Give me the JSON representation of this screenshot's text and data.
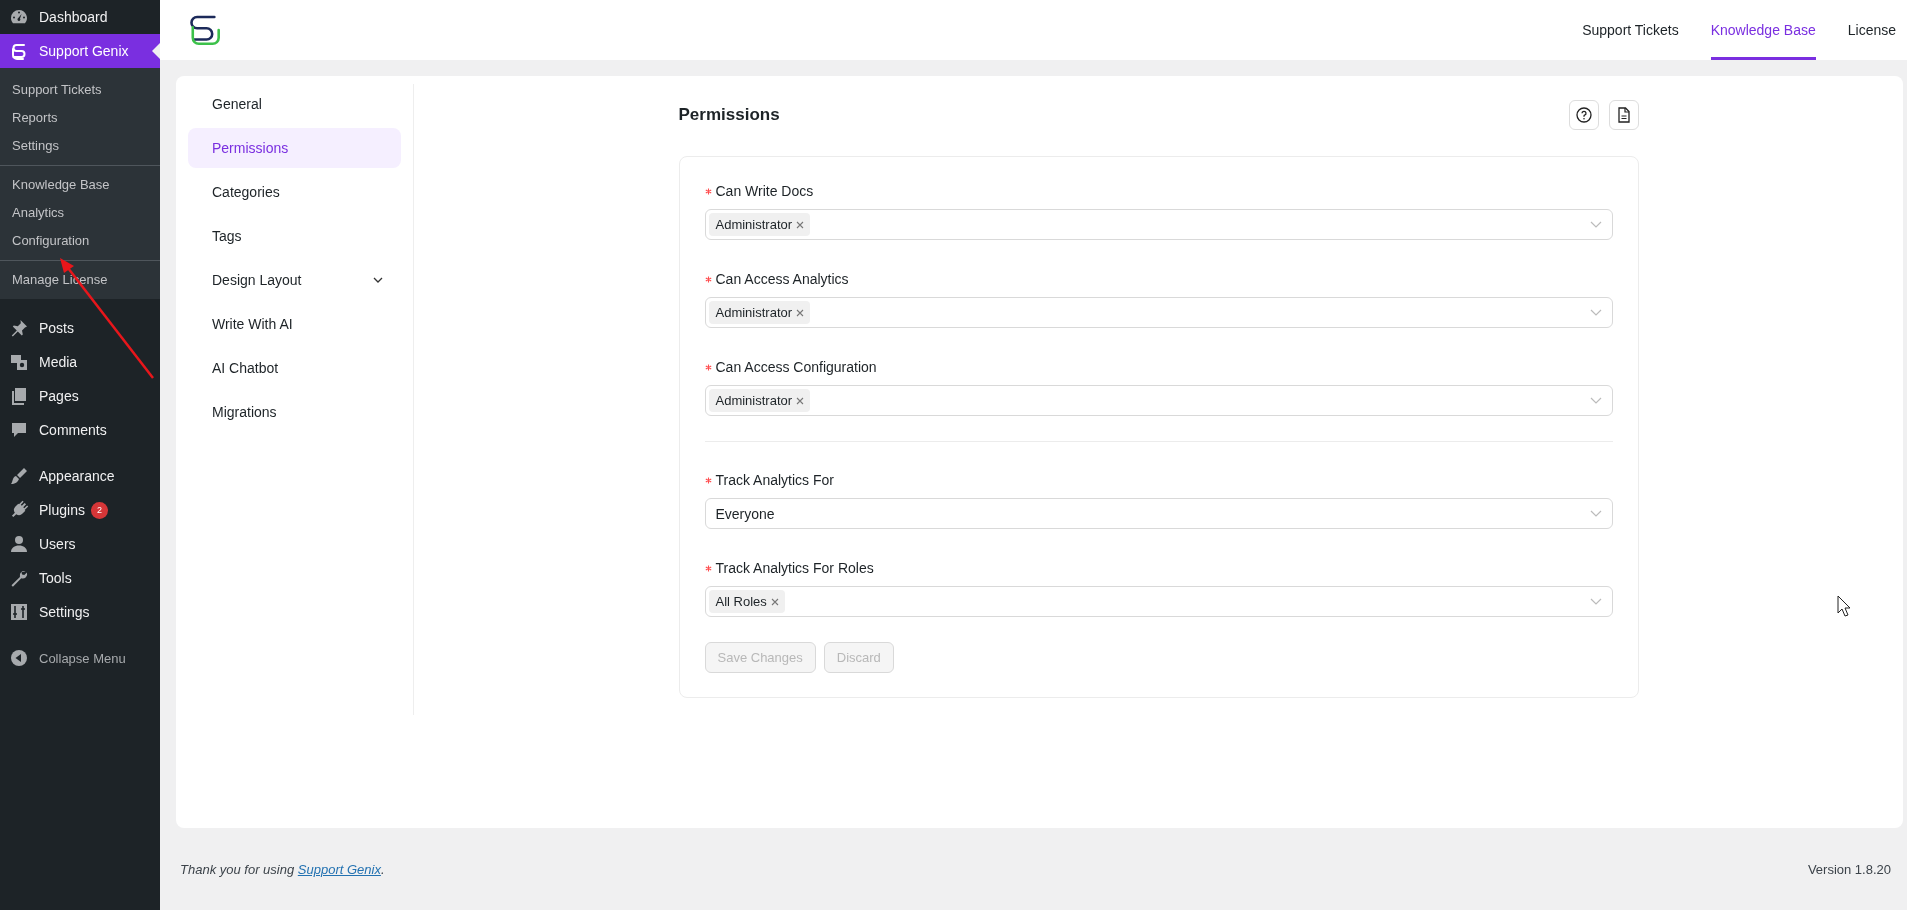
{
  "sidebar": {
    "groups": [
      {
        "items": [
          {
            "label": "Dashboard",
            "kind": "dashboard",
            "selected": false
          },
          {
            "label": "Support Genix",
            "kind": "genix",
            "selected": true,
            "submenu": [
              {
                "items": [
                  {
                    "label": "Support Tickets",
                    "selected": false
                  },
                  {
                    "label": "Reports",
                    "selected": false
                  },
                  {
                    "label": "Settings",
                    "selected": false
                  }
                ]
              },
              {
                "items": [
                  {
                    "label": "Knowledge Base",
                    "selected": false
                  },
                  {
                    "label": "Analytics",
                    "selected": false
                  },
                  {
                    "label": "Configuration",
                    "selected": false
                  }
                ]
              },
              {
                "items": [
                  {
                    "label": "Manage License",
                    "selected": false
                  }
                ]
              }
            ]
          }
        ]
      },
      {
        "items": [
          {
            "label": "Posts",
            "kind": "posts",
            "selected": false
          },
          {
            "label": "Media",
            "kind": "media",
            "selected": false
          },
          {
            "label": "Pages",
            "kind": "pages",
            "selected": false
          },
          {
            "label": "Comments",
            "kind": "comments",
            "selected": false
          }
        ]
      },
      {
        "items": [
          {
            "label": "Appearance",
            "kind": "appearance",
            "selected": false
          },
          {
            "label": "Plugins",
            "kind": "plugins",
            "selected": false,
            "badge": "2"
          },
          {
            "label": "Users",
            "kind": "users",
            "selected": false
          },
          {
            "label": "Tools",
            "kind": "tools",
            "selected": false
          },
          {
            "label": "Settings",
            "kind": "settings",
            "selected": false
          }
        ]
      }
    ],
    "collapse_label": "Collapse Menu"
  },
  "top_nav": [
    {
      "label": "Support Tickets",
      "selected": false
    },
    {
      "label": "Knowledge Base",
      "selected": true
    },
    {
      "label": "License",
      "selected": false
    }
  ],
  "settings_nav": [
    {
      "label": "General",
      "kind": "link",
      "selected": false
    },
    {
      "label": "Permissions",
      "kind": "link",
      "selected": true
    },
    {
      "label": "Categories",
      "kind": "link",
      "selected": false
    },
    {
      "label": "Tags",
      "kind": "link",
      "selected": false
    },
    {
      "label": "Design Layout",
      "kind": "group",
      "selected": false
    },
    {
      "label": "Write With AI",
      "kind": "link",
      "selected": false
    },
    {
      "label": "AI Chatbot",
      "kind": "link",
      "selected": false
    },
    {
      "label": "Migrations",
      "kind": "link",
      "selected": false
    }
  ],
  "panel": {
    "title": "Permissions",
    "sections": [
      {
        "fields": [
          {
            "label": "Can Write Docs",
            "required": true,
            "kind": "tags",
            "tags": [
              "Administrator"
            ]
          },
          {
            "label": "Can Access Analytics",
            "required": true,
            "kind": "tags",
            "tags": [
              "Administrator"
            ]
          },
          {
            "label": "Can Access Configuration",
            "required": true,
            "kind": "tags",
            "tags": [
              "Administrator"
            ]
          }
        ]
      },
      {
        "fields": [
          {
            "label": "Track Analytics For",
            "required": true,
            "kind": "select",
            "value": "Everyone"
          },
          {
            "label": "Track Analytics For Roles",
            "required": true,
            "kind": "tags",
            "tags": [
              "All Roles"
            ]
          }
        ]
      }
    ],
    "buttons": [
      {
        "label": "Save Changes",
        "disabled": true
      },
      {
        "label": "Discard",
        "disabled": true
      }
    ]
  },
  "footer": {
    "text_before": "Thank you for using",
    "link": "Support Genix",
    "text_after": ".",
    "version": "Version 1.8.20"
  }
}
